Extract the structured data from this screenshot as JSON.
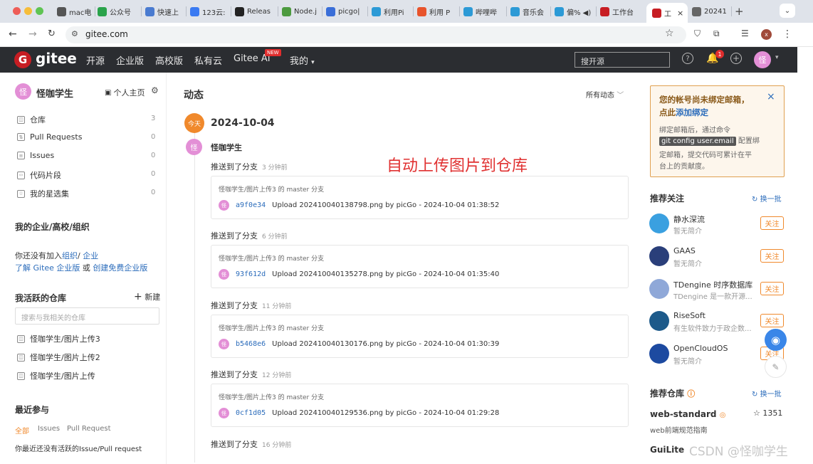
{
  "browser": {
    "tabs": [
      {
        "label": "mac电",
        "icon": "apple-icon",
        "color": "#555"
      },
      {
        "label": "公众号",
        "icon": "wechat-icon",
        "color": "#2aa34b"
      },
      {
        "label": "快速上",
        "icon": "doc-icon",
        "color": "#4a7bd0"
      },
      {
        "label": "123云:",
        "icon": "cloud-icon",
        "color": "#3a7af2"
      },
      {
        "label": "Releas",
        "icon": "github-icon",
        "color": "#222"
      },
      {
        "label": "Node.j",
        "icon": "node-icon",
        "color": "#4c9a3f"
      },
      {
        "label": "picgo|",
        "icon": "paw-icon",
        "color": "#3a6ed8"
      },
      {
        "label": "利用Pi",
        "icon": "bilibili-icon",
        "color": "#2c9ad6"
      },
      {
        "label": "利用 P",
        "icon": "csdn-icon",
        "color": "#e8542c"
      },
      {
        "label": "哔哩哔",
        "icon": "bilibili-icon",
        "color": "#2c9ad6"
      },
      {
        "label": "音乐会",
        "icon": "bilibili-icon",
        "color": "#2c9ad6"
      },
      {
        "label": "偏% ◀)",
        "icon": "bilibili-icon",
        "color": "#2c9ad6"
      },
      {
        "label": "工作台",
        "icon": "gitee-icon",
        "color": "#c71d23"
      },
      {
        "label": "工",
        "icon": "gitee-icon",
        "color": "#c71d23"
      },
      {
        "label": "20241",
        "icon": "globe-icon",
        "color": "#666"
      }
    ],
    "url": "gitee.com"
  },
  "header": {
    "logo_text": "gitee",
    "nav": [
      "开源",
      "企业版",
      "高校版",
      "私有云",
      "Gitee AI",
      "我的"
    ],
    "new_badge": "NEW",
    "search_placeholder": "搜开源",
    "notification_count": "1",
    "avatar_char": "怪"
  },
  "sidebar": {
    "username": "怪咖学生",
    "avatar_char": "怪",
    "homepage": "个人主页",
    "items": [
      {
        "label": "仓库",
        "count": "3"
      },
      {
        "label": "Pull Requests",
        "count": "0"
      },
      {
        "label": "Issues",
        "count": "0"
      },
      {
        "label": "代码片段",
        "count": "0"
      },
      {
        "label": "我的星选集",
        "count": "0"
      }
    ],
    "org_title": "我的企业/高校/组织",
    "org_text1": "你还没有加入",
    "org_link1": "组织",
    "org_slash": "/",
    "org_link2": "企业",
    "org_text2a": "了解 Gitee 企业版",
    "org_text2b": "或",
    "org_text2c": "创建免费企业版",
    "active_repos_title": "我活跃的仓库",
    "new_label": "新建",
    "repo_search_placeholder": "搜索与我相关的仓库",
    "repos": [
      "怪咖学生/图片上传3",
      "怪咖学生/图片上传2",
      "怪咖学生/图片上传"
    ],
    "recent_title": "最近参与",
    "recent_tabs": [
      "全部",
      "Issues",
      "Pull Request"
    ],
    "recent_empty": "你最近还没有活跃的Issue/Pull request"
  },
  "main": {
    "title": "动态",
    "filter": "所有动态",
    "today_badge": "今天",
    "date": "2024-10-04",
    "user": "怪咖学生",
    "user_avatar_char": "怪",
    "annotation": "自动上传图片到仓库",
    "pushes": [
      {
        "label": "推送到了分支",
        "time": "3 分钟前",
        "branch": "怪咖学生/图片上传3 的 master 分支",
        "sha": "a9f0e34",
        "message": "Upload 202410040138798.png by picGo - 2024-10-04 01:38:52"
      },
      {
        "label": "推送到了分支",
        "time": "6 分钟前",
        "branch": "怪咖学生/图片上传3 的 master 分支",
        "sha": "93f612d",
        "message": "Upload 202410040135278.png by picGo - 2024-10-04 01:35:40"
      },
      {
        "label": "推送到了分支",
        "time": "11 分钟前",
        "branch": "怪咖学生/图片上传3 的 master 分支",
        "sha": "b5468e6",
        "message": "Upload 202410040130176.png by picGo - 2024-10-04 01:30:39"
      },
      {
        "label": "推送到了分支",
        "time": "12 分钟前",
        "branch": "怪咖学生/图片上传3 的 master 分支",
        "sha": "0cf1d05",
        "message": "Upload 202410040129536.png by picGo - 2024-10-04 01:29:28"
      },
      {
        "label": "推送到了分支",
        "time": "16 分钟前"
      }
    ]
  },
  "right": {
    "notice_title1": "您的帐号尚未绑定邮箱，",
    "notice_title2a": "点此",
    "notice_title2b": "添加绑定",
    "notice_body1": "绑定邮箱后，通过命令",
    "notice_code": "git config user.email",
    "notice_body2": "配置绑",
    "notice_body3": "定邮箱，提交代码可累计在平",
    "notice_body4": "台上的贡献度。",
    "rec_title": "推荐关注",
    "refresh": "换一批",
    "recs": [
      {
        "name": "静水深流",
        "desc": "暂无简介",
        "logo_color": "#3aa0e0"
      },
      {
        "name": "GAAS",
        "desc": "暂无简介",
        "logo_color": "#2a3f7a"
      },
      {
        "name": "TDengine 时序数据库",
        "desc": "TDengine 是一款开源...",
        "logo_color": "#8fa8d8"
      },
      {
        "name": "RiseSoft",
        "desc": "有生软件致力于政企数...",
        "logo_color": "#1d5a8a"
      },
      {
        "name": "OpenCloudOS",
        "desc": "暂无简介",
        "logo_color": "#1d4aa0"
      }
    ],
    "follow_label": "关注",
    "repo_title": "推荐仓库",
    "repo_refresh": "换一批",
    "repo_name": "web-standard",
    "repo_stars": "1351",
    "repo_desc": "web前端规范指南",
    "repo2_name": "GuiLite",
    "watermark": "CSDN @怪咖学生"
  }
}
